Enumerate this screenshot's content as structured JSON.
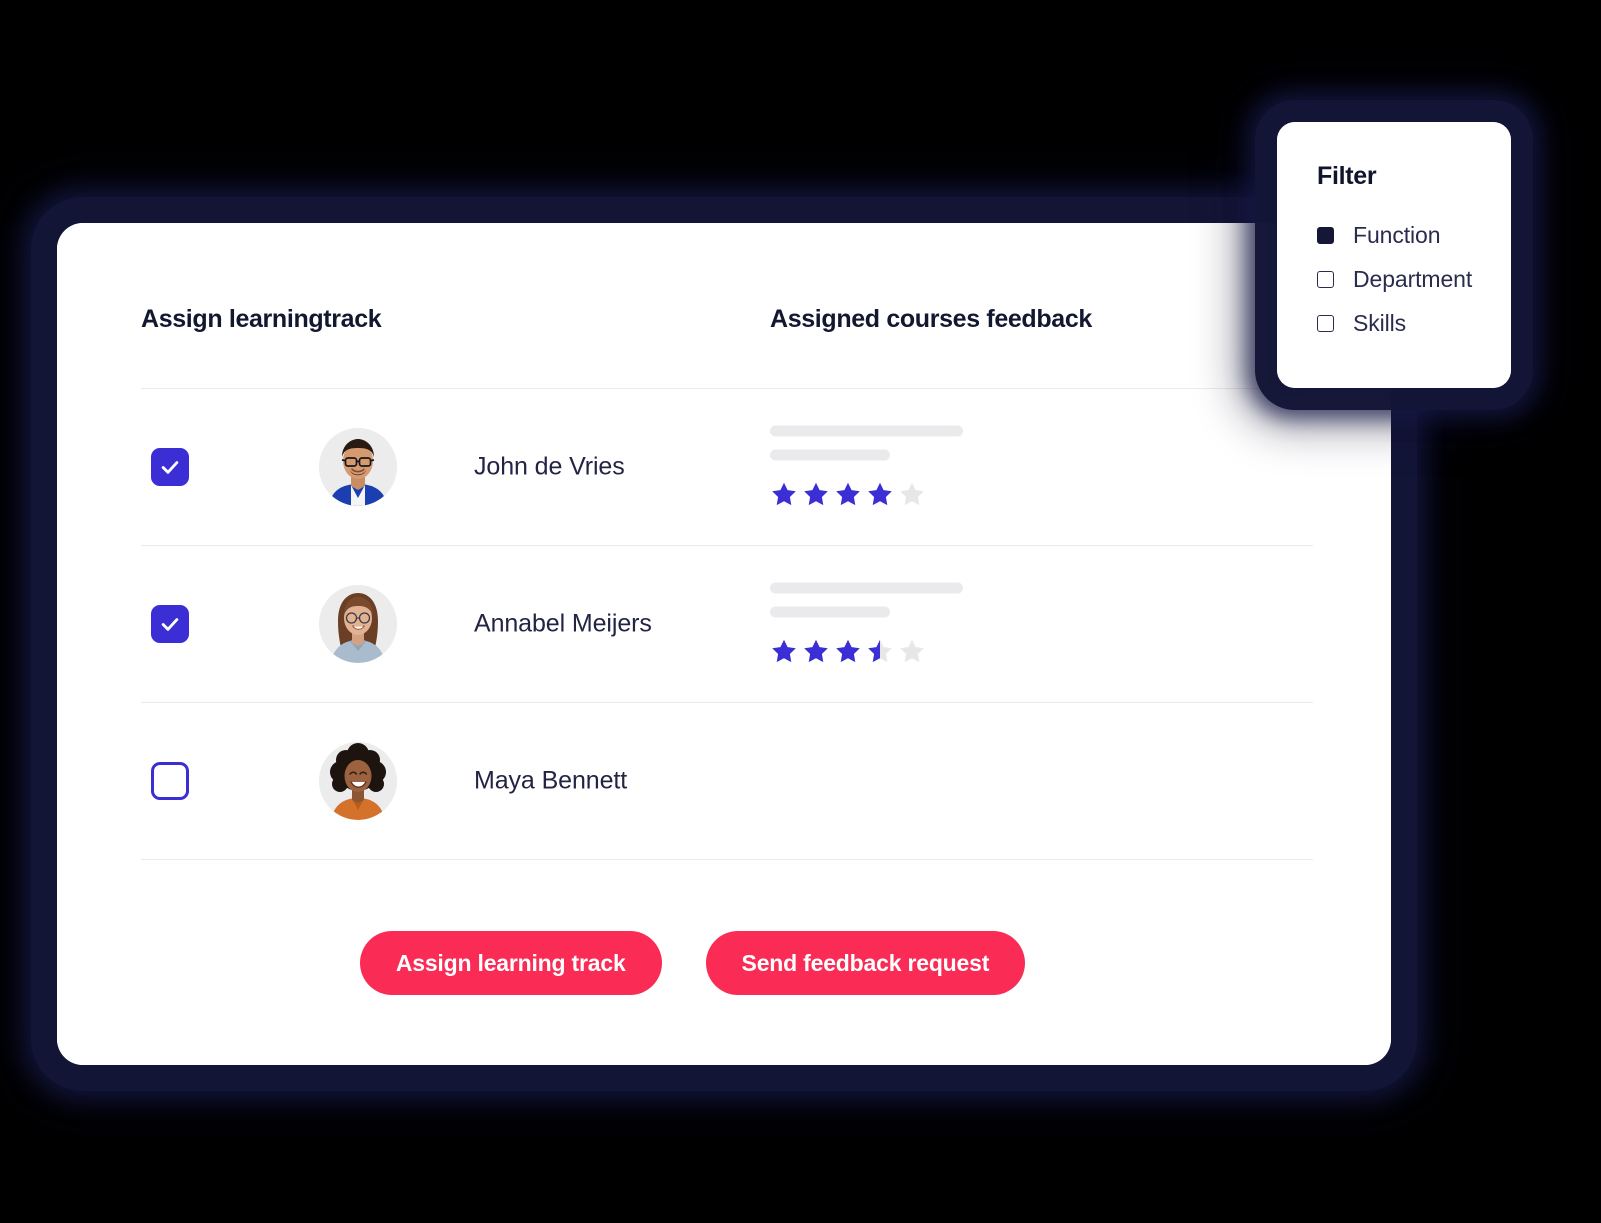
{
  "theme": {
    "background": "#000000",
    "card_background": "#ffffff",
    "glow": "#141836",
    "accent_checkbox": "#3a2ed4",
    "accent_star": "#3a2ed4",
    "star_empty": "#e7e7ea",
    "accent_button": "#fa2b54",
    "heading_color": "#11182f",
    "name_color": "#232444",
    "divider_color": "#ebebee",
    "skeleton_color": "#eaeaec"
  },
  "main": {
    "columns": {
      "assign": "Assign learningtrack",
      "feedback": "Assigned courses feedback"
    },
    "rows": [
      {
        "name": "John de Vries",
        "checked": true,
        "checkbox_state": "checked",
        "avatar": "avatar-man-glasses",
        "rating": 4,
        "rating_max": 5,
        "has_feedback": true
      },
      {
        "name": "Annabel Meijers",
        "checked": true,
        "checkbox_state": "checked",
        "avatar": "avatar-woman-long-hair",
        "rating": 3.5,
        "rating_max": 5,
        "has_feedback": true
      },
      {
        "name": "Maya Bennett",
        "checked": false,
        "checkbox_state": "unchecked",
        "avatar": "avatar-woman-curly-hair",
        "rating": null,
        "rating_max": 5,
        "has_feedback": false
      }
    ],
    "actions": {
      "assign_label": "Assign learning track",
      "feedback_label": "Send feedback request"
    }
  },
  "filter": {
    "title": "Filter",
    "options": [
      {
        "label": "Function",
        "checked": true
      },
      {
        "label": "Department",
        "checked": false
      },
      {
        "label": "Skills",
        "checked": false
      }
    ]
  },
  "icons": {
    "checkmark": "checkmark-icon",
    "star_full": "star-full-icon",
    "star_half": "star-half-icon",
    "star_empty": "star-empty-icon"
  }
}
